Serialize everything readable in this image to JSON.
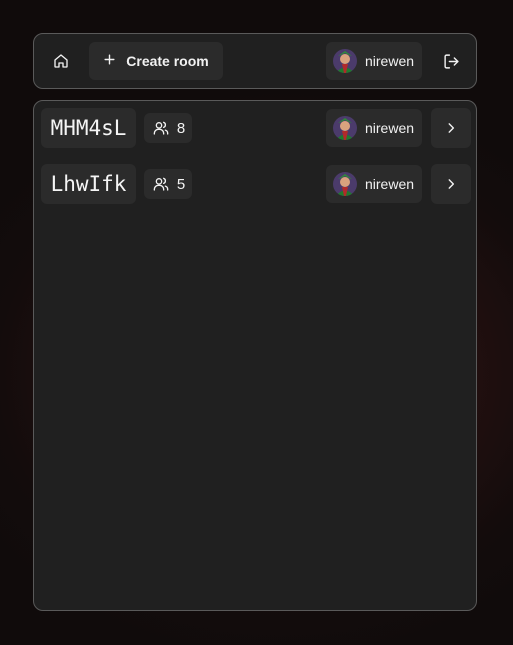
{
  "topbar": {
    "create_room_label": "Create room",
    "user": {
      "name": "nirewen",
      "avatar": "avatar-icon"
    }
  },
  "rooms": [
    {
      "code": "MHM4sL",
      "players": "8",
      "owner": "nirewen"
    },
    {
      "code": "LhwIfk",
      "players": "5",
      "owner": "nirewen"
    }
  ],
  "colors": {
    "panel_bg": "#202020",
    "button_bg": "#2b2b2b",
    "border": "#5a5a5a",
    "background_glow": "#3a1616"
  }
}
